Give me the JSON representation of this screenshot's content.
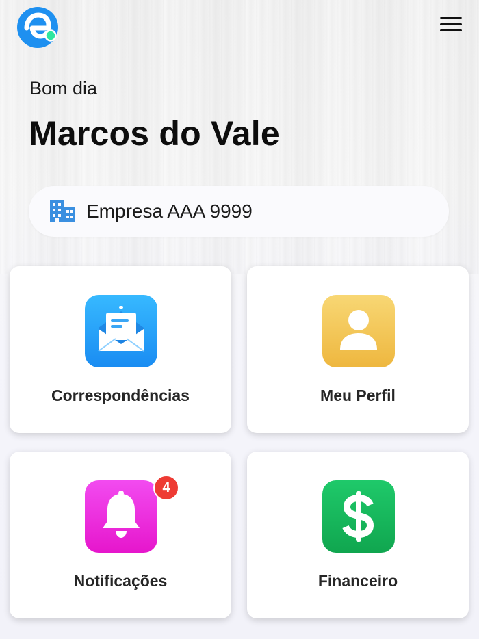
{
  "header": {
    "logo_icon": "app-logo-e-icon",
    "menu_icon": "hamburger-menu-icon"
  },
  "greeting": {
    "salutation": "Bom dia",
    "name": "Marcos do Vale"
  },
  "company": {
    "icon": "building-icon",
    "name": "Empresa AAA 9999",
    "icon_color": "#3a8fe0"
  },
  "cards": [
    {
      "label": "Correspondências",
      "icon": "envelope-letter-icon",
      "color": "#1a8cf2"
    },
    {
      "label": "Meu Perfil",
      "icon": "user-profile-icon",
      "color": "#eeb73f"
    },
    {
      "label": "Notificações",
      "icon": "bell-icon",
      "color": "#e616cc",
      "badge": "4",
      "badge_color": "#ee3b34"
    },
    {
      "label": "Financeiro",
      "icon": "dollar-icon",
      "color": "#10a64f"
    }
  ],
  "colors": {
    "brand": "#1e90f0",
    "brand_accent": "#2ee6a0"
  }
}
